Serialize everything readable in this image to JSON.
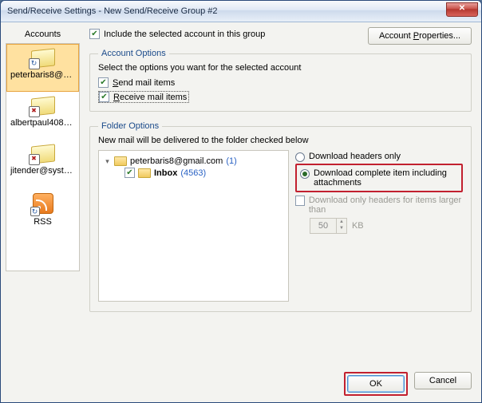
{
  "window": {
    "title": "Send/Receive Settings - New Send/Receive Group #2"
  },
  "sidebar": {
    "header": "Accounts",
    "items": [
      {
        "label": "peterbaris8@g..."
      },
      {
        "label": "albertpaul408@..."
      },
      {
        "label": "jitender@systo..."
      },
      {
        "label": "RSS"
      }
    ]
  },
  "toprow": {
    "include_label": "Include the selected account in this group",
    "props_button": "Account Properties..."
  },
  "account_options": {
    "legend": "Account Options",
    "hint": "Select the options you want for the selected account",
    "send_label": "Send mail items",
    "receive_label": "Receive mail items"
  },
  "folder_options": {
    "legend": "Folder Options",
    "hint": "New mail will be delivered to the folder checked below",
    "tree": {
      "root": "peterbaris8@gmail.com",
      "root_count": "(1)",
      "inbox": "Inbox",
      "inbox_count": "(4563)"
    },
    "download": {
      "headers_only": "Download headers only",
      "complete": "Download complete item including attachments",
      "headers_larger": "Download only headers for items larger than",
      "size_value": "50",
      "size_unit": "KB"
    }
  },
  "footer": {
    "ok": "OK",
    "cancel": "Cancel"
  }
}
